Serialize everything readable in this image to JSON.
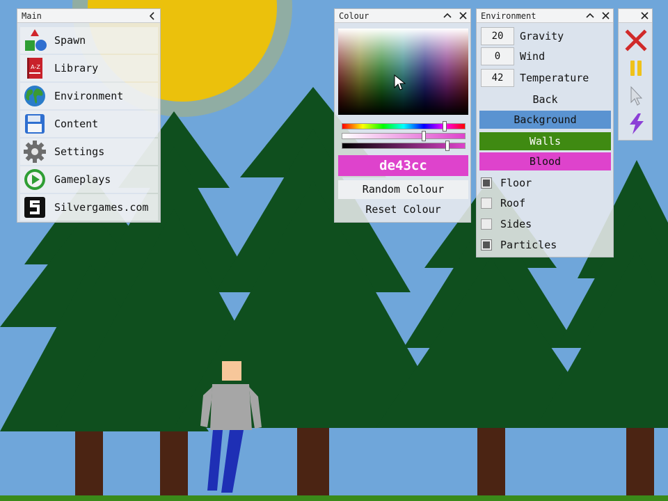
{
  "colors": {
    "sky": "#6fa6da",
    "sun": "#f2c200",
    "tree": "#0f4f1e",
    "trunk": "#4b2413",
    "ground": "#3a8a1a",
    "background_swatch": "#5a93d1",
    "walls_swatch": "#3f8a12",
    "blood_swatch": "#de43cc"
  },
  "main_panel": {
    "title": "Main",
    "collapse_icon": "chevron-left-icon",
    "items": [
      {
        "label": "Spawn",
        "icon": "shapes-icon"
      },
      {
        "label": "Library",
        "icon": "book-az-icon"
      },
      {
        "label": "Environment",
        "icon": "globe-icon"
      },
      {
        "label": "Content",
        "icon": "floppy-disk-icon"
      },
      {
        "label": "Settings",
        "icon": "gear-icon"
      },
      {
        "label": "Gameplays",
        "icon": "play-icon"
      },
      {
        "label": "Silvergames.com",
        "icon": "silvergames-logo-icon"
      }
    ]
  },
  "colour_panel": {
    "title": "Colour",
    "hex_value": "de43cc",
    "random_label": "Random Colour",
    "reset_label": "Reset Colour",
    "sliders": {
      "hue": 0.84,
      "saturation": 0.66,
      "brightness": 0.86
    }
  },
  "environment_panel": {
    "title": "Environment",
    "fields": [
      {
        "value": "20",
        "label": "Gravity"
      },
      {
        "value": "0",
        "label": "Wind"
      },
      {
        "value": "42",
        "label": "Temperature"
      }
    ],
    "back_label": "Back",
    "color_buttons": [
      {
        "label": "Background"
      },
      {
        "label": "Walls"
      },
      {
        "label": "Blood"
      }
    ],
    "toggles": [
      {
        "label": "Floor",
        "checked": true
      },
      {
        "label": "Roof",
        "checked": false
      },
      {
        "label": "Sides",
        "checked": false
      },
      {
        "label": "Particles",
        "checked": true
      }
    ]
  },
  "tool_panel": {
    "tools": [
      "close-x-icon",
      "pause-icon",
      "pointer-icon",
      "lightning-icon"
    ]
  }
}
